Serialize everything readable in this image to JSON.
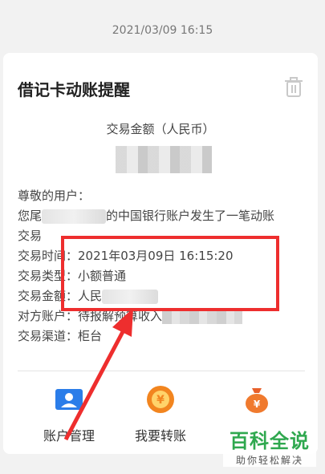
{
  "timestamp": "2021/03/09 16:15",
  "card": {
    "title": "借记卡动账提醒",
    "amount_label": "交易金额（人民币）",
    "greeting": "尊敬的用户：",
    "msg_prefix": "您尾",
    "msg_suffix": "的中国银行账户发生了一笔动账",
    "msg_line2": "交易",
    "details": [
      {
        "label": "交易时间：",
        "value": "2021年03月09日 16:15:20"
      },
      {
        "label": "交易类型：",
        "value": "小额普通"
      },
      {
        "label": "交易金额：",
        "value": "人民"
      },
      {
        "label": "对方账户：",
        "value": "待报解预算收入"
      },
      {
        "label": "交易渠道：",
        "value": "柜台"
      }
    ]
  },
  "actions": [
    {
      "label": "账户管理",
      "icon": "account-manage-icon"
    },
    {
      "label": "我要转账",
      "icon": "transfer-icon"
    },
    {
      "label": "",
      "icon": "money-bag-icon"
    }
  ],
  "watermark": {
    "title": "百科全说",
    "subtitle": "助你轻松解决"
  },
  "colors": {
    "highlight": "#ee2e2e",
    "accent_blue": "#2b7de9",
    "accent_orange": "#f2851f",
    "watermark_green": "#2fa84f"
  }
}
